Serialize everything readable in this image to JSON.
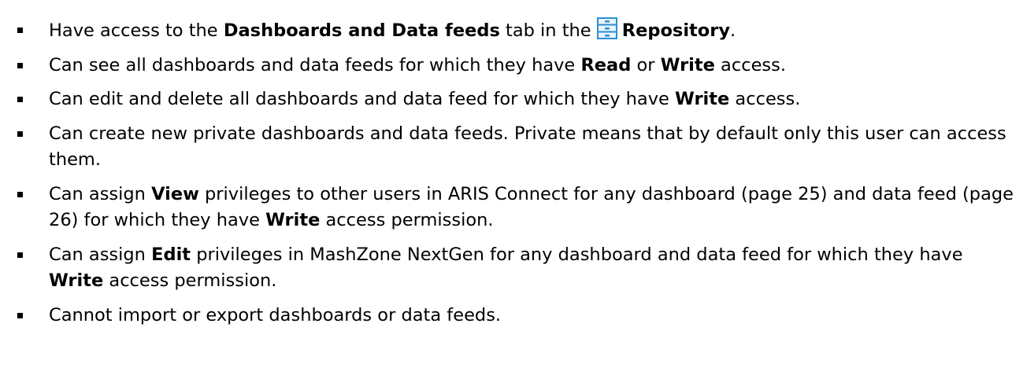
{
  "items": [
    {
      "t1": "Have access to the ",
      "b1": "Dashboards and Data feeds",
      "t2": " tab in the ",
      "icon": "repository-icon",
      "b2": "Repository",
      "t3": "."
    },
    {
      "t1": "Can see all dashboards and data feeds for which they have ",
      "b1": "Read",
      "t2": " or ",
      "b2": "Write",
      "t3": " access."
    },
    {
      "t1": "Can edit and delete all dashboards and data feed for which they have ",
      "b1": "Write",
      "t2": " access."
    },
    {
      "t1": "Can create new private dashboards and data feeds. Private means that by default only this user can access them."
    },
    {
      "t1": "Can assign ",
      "b1": "View",
      "t2": " privileges to other users in ARIS Connect for any dashboard (page 25) and data feed (page 26) for which they have ",
      "b2": "Write",
      "t3": " access permission."
    },
    {
      "t1": "Can assign ",
      "b1": "Edit",
      "t2": " privileges in MashZone NextGen for any dashboard and data feed for which they have ",
      "b2": "Write",
      "t3": " access permission."
    },
    {
      "t1": "Cannot import or export dashboards or data feeds."
    }
  ],
  "colors": {
    "text": "#000000",
    "icon_accent": "#2b8fd6"
  }
}
